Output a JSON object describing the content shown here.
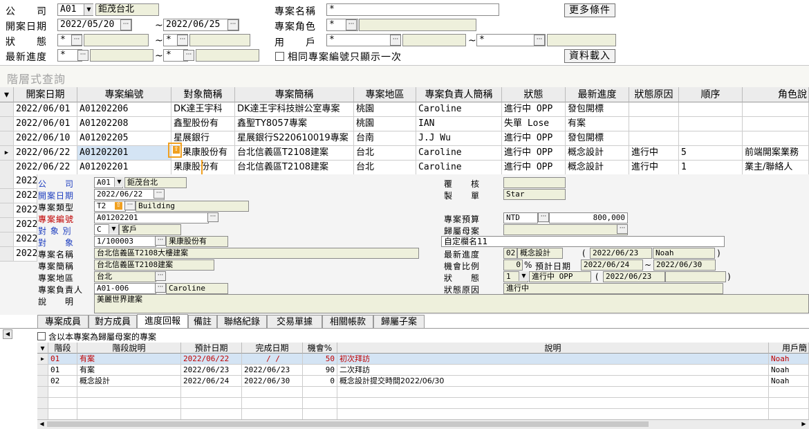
{
  "filters": {
    "company_label": "公　　司",
    "company_code": "A01",
    "company_name": "鉅茂台北",
    "date_label": "開案日期",
    "date_from": "2022/05/20",
    "date_to": "2022/06/25",
    "status_label": "狀　　態",
    "status_val1": "*",
    "status_val2": "*",
    "progress_label": "最新進度",
    "progress_val1": "*",
    "progress_val2": "*",
    "tilde": "~",
    "project_name_label": "專案名稱",
    "project_name_val": "*",
    "project_role_label": "專案角色",
    "project_role_val": "*",
    "user_label": "用　　戶",
    "user_val1": "*",
    "user_val2": "*",
    "same_no_once_label": "相同專案編號只顯示一次",
    "more_conditions": "更多條件",
    "load_data": "資料載入"
  },
  "hier_title": "階層式查詢",
  "grid": {
    "columns": [
      "開案日期",
      "專案編號",
      "對象簡稱",
      "專案簡稱",
      "專案地區",
      "專案負責人簡稱",
      "狀態",
      "最新進度",
      "狀態原因",
      "順序",
      "角色說"
    ],
    "rows": [
      [
        "2022/06/01",
        "A01202206",
        "DK達王宇科",
        "DK達王宇科技辦公室專案",
        "桃園",
        "Caroline",
        "進行中 OPP",
        "發包開標",
        "",
        "",
        ""
      ],
      [
        "2022/06/01",
        "A01202208",
        "鑫聖股份有",
        "鑫聖TY8057專案",
        "桃園",
        "IAN",
        "失單 Lose",
        "有案",
        "",
        "",
        ""
      ],
      [
        "2022/06/10",
        "A01202205",
        "星展銀行",
        "星展銀行S220610019專案",
        "台南",
        "J.J Wu",
        "進行中 OPP",
        "發包開標",
        "",
        "",
        ""
      ],
      [
        "2022/06/22",
        "A01202201",
        "果康股份有",
        "台北信義區T2108建案",
        "台北",
        "Caroline",
        "進行中 OPP",
        "概念設計",
        "進行中",
        "5",
        "前端開案業務"
      ],
      [
        "2022/06/22",
        "A01202201",
        "果康股份有",
        "台北信義區T2108建案",
        "台北",
        "Caroline",
        "進行中 OPP",
        "概念設計",
        "進行中",
        "1",
        "業主/聯絡人"
      ]
    ],
    "hidden_rows": [
      "2022",
      "2022",
      "2022",
      "2022",
      "2022",
      "2022"
    ]
  },
  "detail": {
    "company_label": "公　　司",
    "company_code": "A01",
    "company_name": "鉅茂台北",
    "open_date_label": "開案日期",
    "open_date": "2022/06/22",
    "type_label": "專案類型",
    "type_code": "T2",
    "type_name": "Building",
    "no_label": "專案編號",
    "no": "A01202201",
    "target_type_label": "對 象 別",
    "target_type_code": "C",
    "target_type_name": "客戶",
    "target_label": "對　　象",
    "target_code": "1/100003",
    "target_name": "果康股份有",
    "name_label": "專案名稱",
    "name": "台北信義區T2108大樓建案",
    "short_label": "專案簡稱",
    "short": "台北信義區T2108建案",
    "area_label": "專案地區",
    "area": "台北",
    "owner_label": "專案負責人",
    "owner_code": "A01-006",
    "owner_name": "Caroline",
    "desc_label": "說　　明",
    "desc": "美麗世界建案",
    "review_label": "覆　　核",
    "review": "",
    "maker_label": "製　　單",
    "maker": "Star",
    "budget_label": "專案預算",
    "budget_cur": "NTD",
    "budget": "800,000",
    "parent_label": "歸屬母案",
    "parent": "",
    "custom_label": "自定欄名11",
    "custom": "",
    "latest_label": "最新進度",
    "latest_code": "02",
    "latest_name": "概念設計",
    "latest_date": "2022/06/23",
    "latest_user": "Noah",
    "ratio_label": "機會比例",
    "ratio": "0",
    "pct": "%",
    "est_label": "預計日期",
    "est_from": "2022/06/24",
    "est_to": "2022/06/30",
    "status_label": "狀　　態",
    "status_code": "1",
    "status_name": "進行中 OPP",
    "status_date": "2022/06/23",
    "reason_label": "狀態原因",
    "reason": "進行中",
    "lp": "(",
    "rp": ")",
    "tilde": "~"
  },
  "tabs": [
    "專案成員",
    "對方成員",
    "進度回報",
    "備註",
    "聯絡紀錄",
    "交易單據",
    "相關帳款",
    "歸屬子案"
  ],
  "active_tab": "進度回報",
  "include_parent_label": "含以本專案為歸屬母案的專案",
  "subgrid": {
    "columns": [
      "階段",
      "階段說明",
      "預計日期",
      "完成日期",
      "機會%",
      "說明",
      "用戶簡"
    ],
    "rows": [
      [
        "01",
        "有案",
        "2022/06/22",
        "/  /",
        "50",
        "初次拜訪",
        "Noah"
      ],
      [
        "01",
        "有案",
        "2022/06/23",
        "2022/06/23",
        "90",
        "二次拜訪",
        "Noah"
      ],
      [
        "02",
        "概念設計",
        "2022/06/24",
        "2022/06/30",
        "0",
        "概念設計提交時間2022/06/30",
        "Noah"
      ]
    ]
  },
  "colors": {
    "highlight_row": "#d4e4f4",
    "label_blue": "#2040c0",
    "label_red": "#c00000",
    "warn_orange": "#f0a020"
  }
}
